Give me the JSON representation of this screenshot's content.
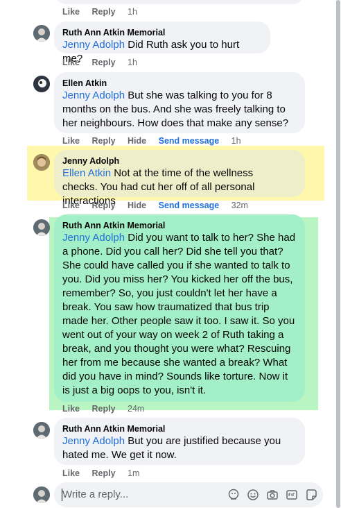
{
  "actions": {
    "like": "Like",
    "reply": "Reply",
    "hide": "Hide",
    "send_message": "Send message"
  },
  "top_partial": {
    "time": "1h"
  },
  "comments": [
    {
      "author": "Ruth Ann Atkin Memorial",
      "mention": "Jenny Adolph",
      "text": " Did Ruth ask you to hurt me?",
      "time": "1h"
    },
    {
      "author": "Ellen Atkin",
      "mention": "Jenny Adolph",
      "text": " But she was talking to you for 8 months on the bus. And she was freely talking to her neighbours. How does that make any sense?",
      "time": "1h"
    },
    {
      "author": "Jenny Adolph",
      "mention": "Ellen Atkin",
      "text": " Not at the time of the wellness checks. You had cut her off of all personal interactions",
      "time": "32m"
    },
    {
      "author": "Ruth Ann Atkin Memorial",
      "mention": "Jenny Adolph",
      "text": " Did you want to talk to her? She had a phone. Did you call her? Did she tell you that? She could have called you if she wanted to talk to you. Did you miss her? You kicked her off the bus, remember? So, you just couldn't let her have a break. You saw how traumatized that bus trip made her. Other people saw it too. I saw it. So you went out of your way on week 2 of Ruth taking a break, and you thought you were what? Rescuing her from me because she wanted a break? What did you have in mind? Sounds like torture. Now it is just a big oops to you, isn't it.",
      "time": "24m"
    },
    {
      "author": "Ruth Ann Atkin Memorial",
      "mention": "Jenny Adolph",
      "text": " But you are justified because you hated me. We get it now.",
      "time": "1m"
    }
  ],
  "reply_box": {
    "placeholder": "Write a reply..."
  },
  "colors": {
    "mention": "#216fdb",
    "bubble": "#f0f2f5",
    "highlight_yellow": "#fff8ac",
    "highlight_green": "#b8f5c2",
    "meta": "#65676b"
  }
}
